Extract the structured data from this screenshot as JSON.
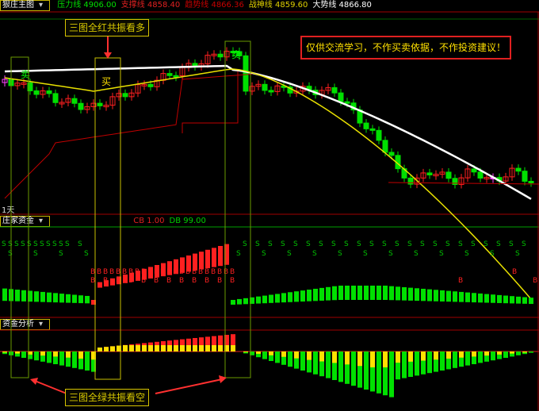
{
  "main_panel": {
    "title": "狠庄主图",
    "indicators": [
      {
        "label": "压力线",
        "value": "4906.00",
        "color": "#00e000"
      },
      {
        "label": "支撑线",
        "value": "4858.40",
        "color": "#e02020"
      },
      {
        "label": "趋势线",
        "value": "4866.36",
        "color": "#c80000"
      },
      {
        "label": "战神线",
        "value": "4859.60",
        "color": "#e0d000"
      },
      {
        "label": "大势线",
        "value": "4866.80",
        "color": "#ffffff"
      }
    ],
    "period_label": "1天",
    "buy_marker": "买",
    "sell_marker": "卖"
  },
  "fund_panel": {
    "title": "庄家资金",
    "indicators": [
      {
        "label": "CB",
        "value": "1.00",
        "color": "#e02020"
      },
      {
        "label": "DB",
        "value": "99.00",
        "color": "#00d000"
      }
    ],
    "s_marker": "S",
    "b_marker": "B"
  },
  "analysis_panel": {
    "title": "资金分析"
  },
  "annotations": {
    "top_callout": "三图全红共振看多",
    "bottom_callout": "三图全绿共振看空",
    "disclaimer": "仅供交流学习，不作买卖依据，不作投资建议！"
  },
  "colors": {
    "up": "#ff2020",
    "down": "#00e000",
    "highlight": "#ff40ff",
    "box": "#c8c000",
    "ma_white": "#ffffff",
    "ma_yellow": "#e8e000",
    "trend": "#c00000"
  }
}
